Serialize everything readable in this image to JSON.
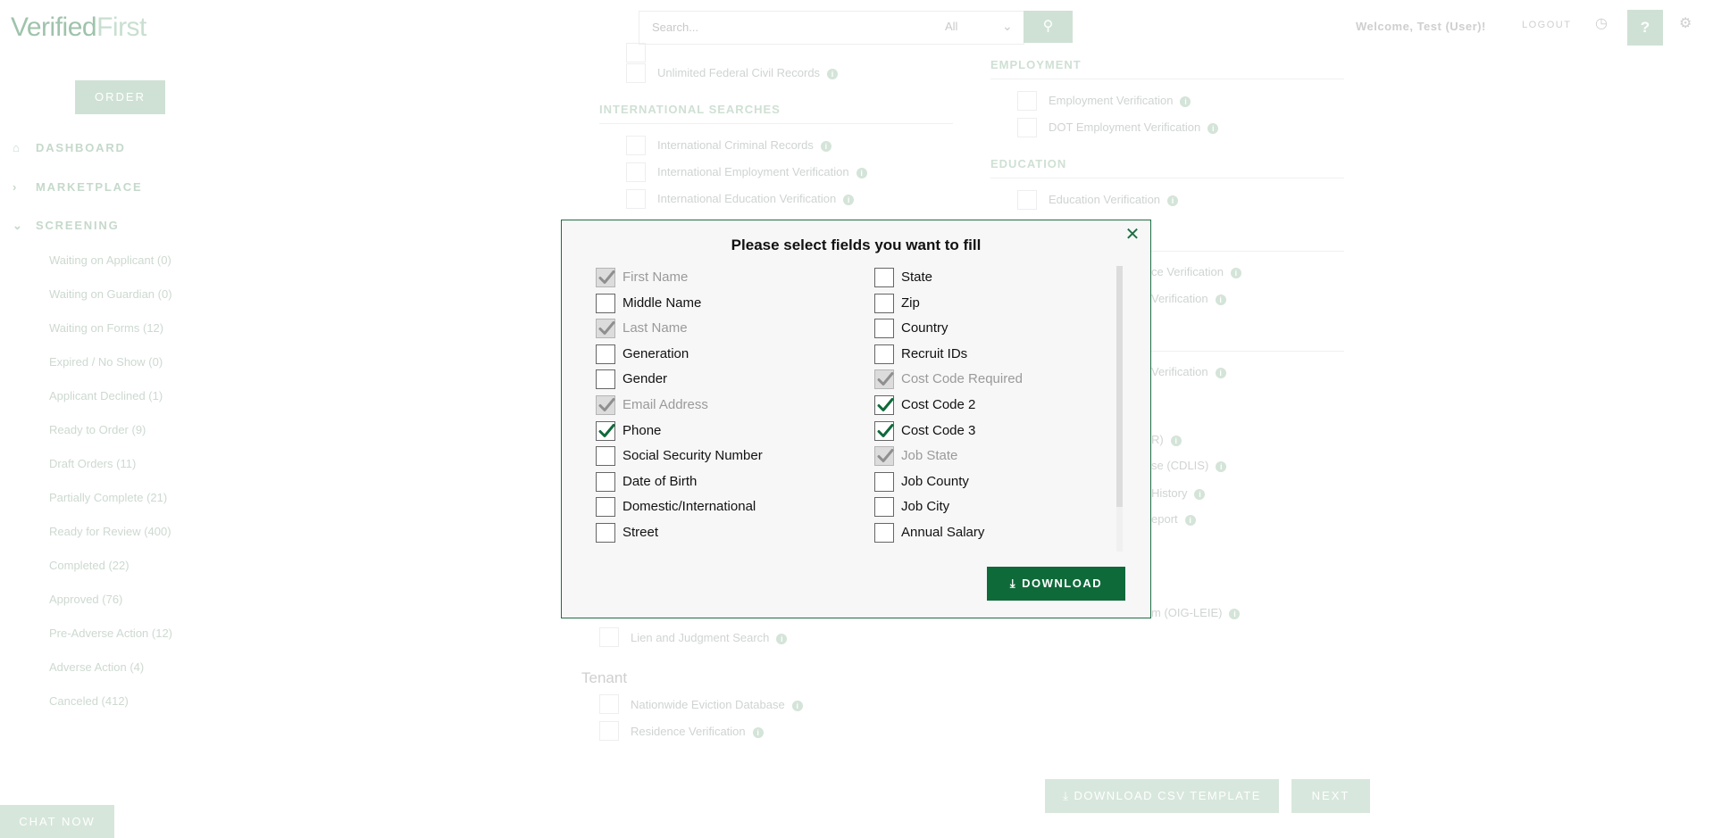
{
  "header": {
    "logo_main": "Verified",
    "logo_accent": "First",
    "search_placeholder": "Search...",
    "search_filter": "All",
    "welcome_prefix": "Welcome, ",
    "welcome_user": "Test (User)",
    "welcome_suffix": "!",
    "logout": "LOGOUT",
    "help": "?"
  },
  "sidebar": {
    "order_button": "ORDER",
    "nav": [
      {
        "label": "DASHBOARD",
        "icon": "home-icon"
      },
      {
        "label": "MARKETPLACE",
        "icon": "chevron-right-icon"
      },
      {
        "label": "SCREENING",
        "icon": "chevron-down-icon"
      }
    ],
    "screening_items": [
      "Waiting on Applicant (0)",
      "Waiting on Guardian (0)",
      "Waiting on Forms (12)",
      "Expired / No Show (0)",
      "Applicant Declined (1)",
      "Ready to Order (9)",
      "Draft Orders (11)",
      "Partially Complete (21)",
      "Ready for Review (400)",
      "Completed (22)",
      "Approved (76)",
      "Pre-Adverse Action (12)",
      "Adverse Action (4)",
      "Canceled (412)"
    ],
    "chat_now": "CHAT NOW"
  },
  "background": {
    "federal_item": "Unlimited Federal Civil Records",
    "international_title": "INTERNATIONAL SEARCHES",
    "international_items": [
      "International Criminal Records",
      "International Employment Verification",
      "International Education Verification"
    ],
    "employment_title": "EMPLOYMENT",
    "employment_items": [
      "Employment Verification",
      "DOT Employment Verification"
    ],
    "education_title": "EDUCATION",
    "education_items": [
      "Education Verification"
    ],
    "partial_right_items": [
      "ce Verification",
      "Verification",
      "Verification",
      "R)",
      "se (CDLIS)",
      "History",
      "eport",
      "m (OIG-LEIE)"
    ],
    "lien_item": "Lien and Judgment Search",
    "tenant_title": "Tenant",
    "tenant_items": [
      "Nationwide Eviction Database",
      "Residence Verification"
    ],
    "csv_button": "DOWNLOAD CSV TEMPLATE",
    "next_button": "NEXT"
  },
  "modal": {
    "title": "Please select fields you want to fill",
    "download_button": "DOWNLOAD",
    "left_fields": [
      {
        "label": "First Name",
        "state": "checked-disabled"
      },
      {
        "label": "Middle Name",
        "state": "unchecked"
      },
      {
        "label": "Last Name",
        "state": "checked-disabled"
      },
      {
        "label": "Generation",
        "state": "unchecked"
      },
      {
        "label": "Gender",
        "state": "unchecked"
      },
      {
        "label": "Email Address",
        "state": "checked-disabled"
      },
      {
        "label": "Phone",
        "state": "checked"
      },
      {
        "label": "Social Security Number",
        "state": "unchecked"
      },
      {
        "label": "Date of Birth",
        "state": "unchecked"
      },
      {
        "label": "Domestic/International",
        "state": "unchecked"
      },
      {
        "label": "Street",
        "state": "unchecked"
      }
    ],
    "right_fields": [
      {
        "label": "State",
        "state": "unchecked"
      },
      {
        "label": "Zip",
        "state": "unchecked"
      },
      {
        "label": "Country",
        "state": "unchecked"
      },
      {
        "label": "Recruit IDs",
        "state": "unchecked"
      },
      {
        "label": "Cost Code Required",
        "state": "checked-disabled"
      },
      {
        "label": "Cost Code 2",
        "state": "checked"
      },
      {
        "label": "Cost Code 3",
        "state": "checked"
      },
      {
        "label": "Job State",
        "state": "checked-disabled"
      },
      {
        "label": "Job County",
        "state": "unchecked"
      },
      {
        "label": "Job City",
        "state": "unchecked"
      },
      {
        "label": "Annual Salary",
        "state": "unchecked"
      }
    ]
  },
  "colors": {
    "brand_green": "#0f6a3a",
    "check_green": "#0f6a3a",
    "disabled_gray": "#9a9a9a"
  }
}
